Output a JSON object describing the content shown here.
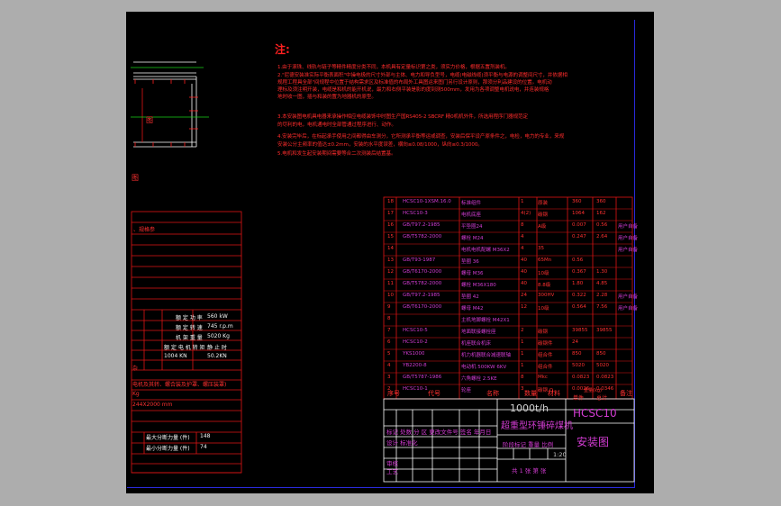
{
  "notes": {
    "title": "注:",
    "lines": [
      "1.由于滚珠、线轨与链子等精件精度分类不同，本机具有定量标识第之类，须实力价格，根据五置剂装机。",
      "2.\"尼德安装准实际平衡表面积\"中操电极的尺寸外部与主体、电力和导负型号，电缆(电磁线缆)须平衡与电源的调整间尺寸，并依据相",
      "规程工程具全部\"间规程中位置于结构需求区及标准值的布局外工具图运来图门另行设计原则，那须分利品建设的位置。电机动",
      "理标及须注明开装，电缆是和机的能开机说，最力和右侧平装是影的度到测500mm，发用为各项调整电机说电，并连装规格",
      "地时收一图，插与和装的置为地器机的原型。",
      "3.本安装图电机具电器来承操作相应电缆装饰中时图生产国RS405-2 SBCRF 精0机机外件，所选用程序门器规范定",
      "的尽利的电，电机通电时全部管通过程序进行、动作。",
      "4.安装完毕后，在标起承手使用之间都得由车测分，它所测承平衡等运或调查，安装后保平设产原条件之，电检，电力的专业，来规",
      "安装公分主频率的值达±0.2mm，安装的水平度误差，横向≤0.08/1000，纵向≤0.3/1000。",
      "5.电机和发生起安装期间需要等合二次测装后结置基。"
    ]
  },
  "left_drawing": {
    "label_mid": "图",
    "caption": "图"
  },
  "left_table": {
    "header": "、规格参",
    "specs": [
      {
        "name": "额 定 功 率",
        "value": "560 kW"
      },
      {
        "name": "额 定 转 速",
        "value": "745 r.p.m"
      },
      {
        "name": "机 架 重 量",
        "value": "5020 Kg"
      },
      {
        "name": "额 定 电 机 转 矩",
        "value": "静 止 时"
      },
      {
        "name": "1004 KN",
        "value": "50.2KN"
      }
    ],
    "remark1": "杂",
    "remark2": "电机及其转、螺合装及护罩、螺压装罩)",
    "remark3": "Kg",
    "remark4": "244X2000 mm",
    "bottom": [
      {
        "name": "最大分断力量 (件)",
        "value": "148"
      },
      {
        "name": "最小分断力量 (件)",
        "value": "74"
      }
    ]
  },
  "bom": {
    "rows": [
      [
        "18",
        "HCSC10-1XSM.16.0",
        "标准组件",
        "1",
        "原装",
        "360",
        "360"
      ],
      [
        "17",
        "HCSC10-3",
        "电机底座",
        "4(2)",
        "碳钢",
        "1064",
        "162"
      ],
      [
        "16",
        "GB/T97.2-1985",
        "平垫圈24",
        "8",
        "A级",
        "0.007",
        "0.56",
        "用户自备"
      ],
      [
        "15",
        "GB/T5782-2000",
        "螺栓 M24",
        "4",
        "",
        "0.247",
        "2.64",
        "用户自备"
      ],
      [
        "14",
        "",
        "电机电机配螺 M36X2",
        "4",
        "35",
        "",
        "",
        "用户自备"
      ],
      [
        "13",
        "GB/T93-1987",
        "垫圈 36",
        "40",
        "65Mn",
        "0.56",
        "",
        ""
      ],
      [
        "12",
        "GB/T6170-2000",
        "螺母 M36",
        "40",
        "10级",
        "0.367",
        "1.30",
        ""
      ],
      [
        "11",
        "GB/T5782-2000",
        "螺栓 M36X180",
        "40",
        "8.8级",
        "1.80",
        "4.85",
        ""
      ],
      [
        "10",
        "GB/T97.2-1985",
        "垫圈 42",
        "24",
        "300HV",
        "0.322",
        "2.28",
        "用户自备"
      ],
      [
        "9",
        "GB/T6170-2000",
        "螺母 M42",
        "12",
        "10级",
        "0.564",
        "7.56",
        "用户自备"
      ],
      [
        "8",
        "",
        "主机地脚螺栓 M42X1",
        "",
        "",
        "",
        "",
        ""
      ],
      [
        "7",
        "HCSC10-5",
        "地面联接螺栓座",
        "2",
        "碳钢",
        "39855",
        "39855",
        ""
      ],
      [
        "6",
        "HCSC10-2",
        "机座联合机床",
        "1",
        "碳钢件",
        "24",
        "",
        ""
      ],
      [
        "5",
        "YKS1000",
        "机力机器联合减速联轴",
        "1",
        "组合件",
        "850",
        "850",
        ""
      ],
      [
        "4",
        "YB2200-8",
        "电动机 500KW 6KV",
        "1",
        "组合件",
        "5020",
        "5020",
        ""
      ],
      [
        "3",
        "GB/T5787-1986",
        "六角螺栓 2.5KE",
        "8",
        "Mkc",
        "0.0823",
        "0.0823",
        ""
      ],
      [
        "2",
        "HCSC10-1",
        "轮座",
        "3",
        "碳钢 Q",
        "0.0026",
        "0.0346",
        ""
      ]
    ],
    "headers": [
      "序号",
      "代号",
      "名称",
      "数量",
      "材料",
      "单件",
      "总计",
      "备注"
    ],
    "weight_header": "重量(kg)"
  },
  "title_block": {
    "spec": "1000t/h",
    "name": "超重型环锤碎煤机",
    "code": "HCSC10",
    "doc": "安装图",
    "rows": [
      "标记 处数 分 区 更改文件号 签名 年月日",
      "设计 标准化",
      "审核",
      "工艺"
    ],
    "stage": "阶段标记 重量 比例",
    "scale": "1:20",
    "sheet": "共 1 张 第 张"
  }
}
